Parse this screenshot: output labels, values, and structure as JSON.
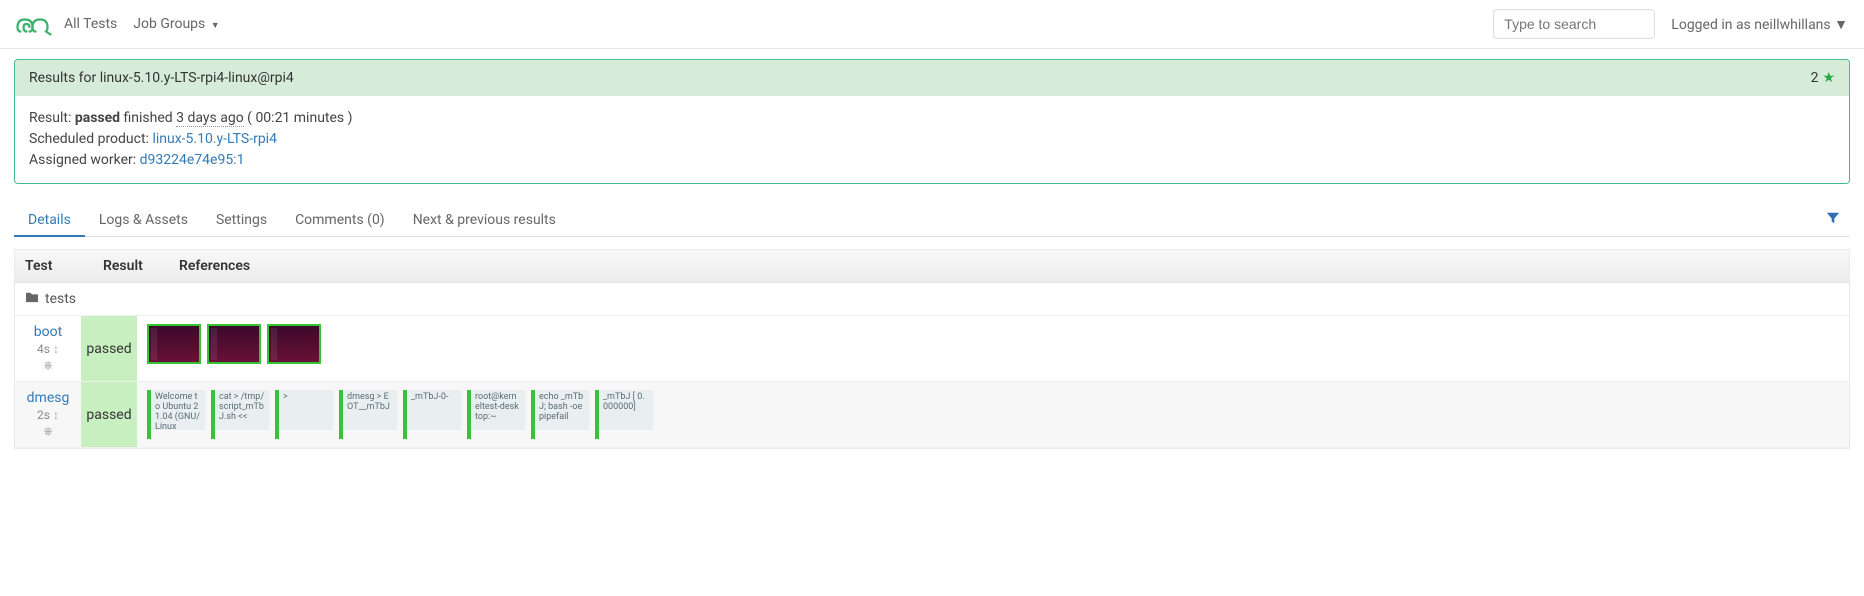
{
  "nav": {
    "all_tests": "All Tests",
    "job_groups": "Job Groups",
    "search_placeholder": "Type to search",
    "logged_in": "Logged in as neillwhillans"
  },
  "panel": {
    "title": "Results for linux-5.10.y-LTS-rpi4-linux@rpi4",
    "star_count": "2",
    "result_label": "Result: ",
    "result_value": "passed",
    "finished": " finished ",
    "finished_ago": "3 days ago",
    "duration": " ( 00:21 minutes )",
    "scheduled_label": "Scheduled product: ",
    "scheduled_link": "linux-5.10.y-LTS-rpi4",
    "assigned_label": "Assigned worker: ",
    "assigned_link": "d93224e74e95:1"
  },
  "tabs": {
    "details": "Details",
    "logs": "Logs & Assets",
    "settings": "Settings",
    "comments": "Comments (0)",
    "nextprev": "Next & previous results"
  },
  "table": {
    "h_test": "Test",
    "h_result": "Result",
    "h_refs": "References",
    "folder": "tests"
  },
  "rows": [
    {
      "name": "boot",
      "time": "4s",
      "result": "passed",
      "thumbs": 3,
      "snippets": []
    },
    {
      "name": "dmesg",
      "time": "2s",
      "result": "passed",
      "thumbs": 0,
      "snippets": [
        "Welcome to Ubuntu 21.04 (GNU/Linux",
        "cat > /tmp/script_mTbJ.sh <<",
        ">",
        "dmesg > EOT__mTbJ",
        "_mTbJ-0-",
        "root@kerneltest-desktop:~",
        "echo _mTbJ; bash -oe pipefail",
        "_mTbJ [ 0.000000]"
      ]
    }
  ]
}
